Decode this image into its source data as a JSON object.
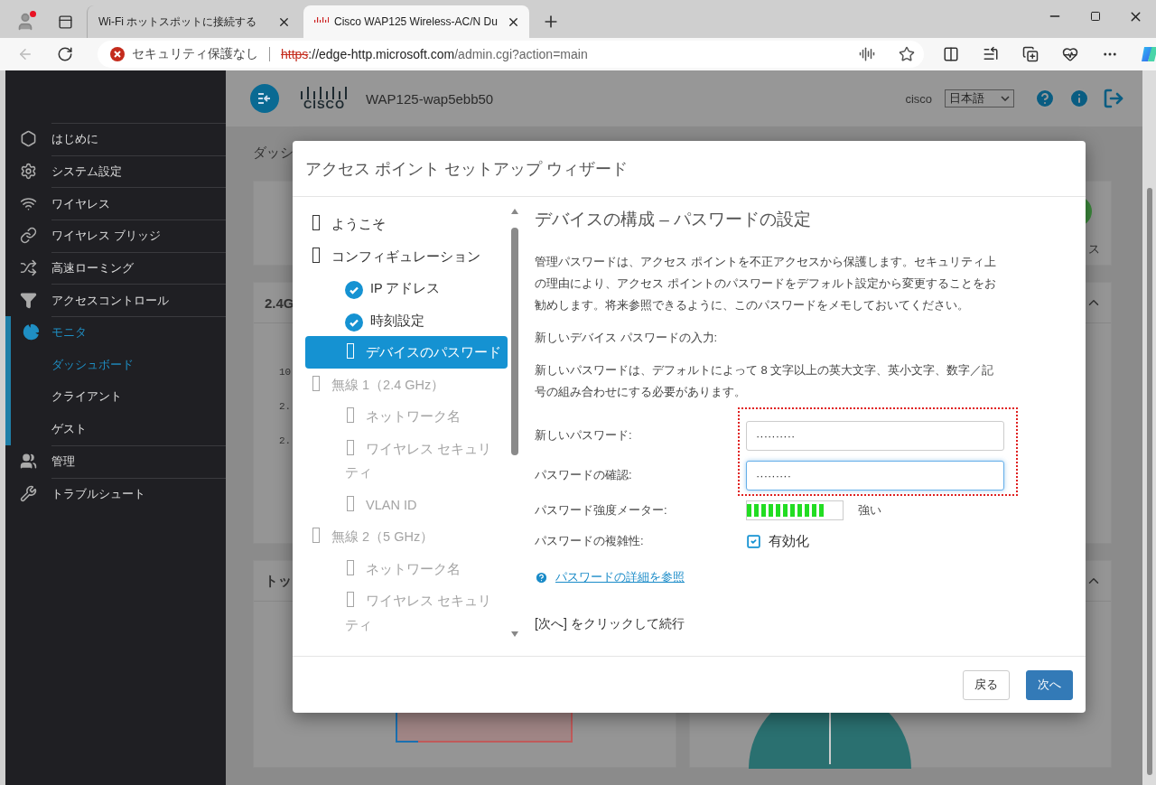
{
  "browser": {
    "tabs": [
      {
        "title": "Wi-Fi ホットスポットに接続する",
        "selected": false
      },
      {
        "title": "Cisco WAP125 Wireless-AC/N Du",
        "selected": true
      }
    ],
    "security_label": "セキュリティ保護なし",
    "url": {
      "scheme": "https",
      "host": "://edge-http.microsoft.com",
      "path": "/admin.cgi?action=main"
    }
  },
  "sidebar": {
    "items": [
      {
        "label": "はじめに",
        "selected": false
      },
      {
        "label": "システム設定",
        "selected": false
      },
      {
        "label": "ワイヤレス",
        "selected": false
      },
      {
        "label": "ワイヤレス ブリッジ",
        "selected": false
      },
      {
        "label": "高速ローミング",
        "selected": false
      },
      {
        "label": "アクセスコントロール",
        "selected": false
      },
      {
        "label": "モニタ",
        "selected": true,
        "children": [
          {
            "label": "ダッシュボード",
            "selected": true
          },
          {
            "label": "クライアント",
            "selected": false
          },
          {
            "label": "ゲスト",
            "selected": false
          }
        ]
      },
      {
        "label": "管理",
        "selected": false
      },
      {
        "label": "トラブルシュート",
        "selected": false
      }
    ]
  },
  "header": {
    "logo": "CISCO",
    "device": "WAP125-wap5ebb50",
    "user": "cisco",
    "language": "日本語"
  },
  "dashboard": {
    "title": "ダッシ",
    "summary_fragment": "ス",
    "panels": [
      {
        "title": "2.4G",
        "axis_labels": [
          "10",
          "2.",
          "2."
        ]
      },
      {
        "title": "トッ"
      }
    ]
  },
  "wizard": {
    "title": "アクセス ポイント セットアップ ウィザード",
    "steps": [
      {
        "label": "ようこそ",
        "completed": false,
        "selected": false,
        "disabled": false
      },
      {
        "label": "コンフィギュレーション",
        "completed": false,
        "selected": false,
        "disabled": false,
        "children": [
          {
            "label": "IP アドレス",
            "completed": true,
            "selected": false,
            "disabled": false
          },
          {
            "label": "時刻設定",
            "completed": true,
            "selected": false,
            "disabled": false
          },
          {
            "label": "デバイスのパスワード",
            "completed": false,
            "selected": true,
            "disabled": false
          }
        ]
      },
      {
        "label": "無線 1（2.4 GHz）",
        "completed": false,
        "selected": false,
        "disabled": true,
        "children": [
          {
            "label": "ネットワーク名",
            "completed": false,
            "selected": false,
            "disabled": true
          },
          {
            "label": "ワイヤレス セキュリティ",
            "completed": false,
            "selected": false,
            "disabled": true
          },
          {
            "label": "VLAN ID",
            "completed": false,
            "selected": false,
            "disabled": true
          }
        ]
      },
      {
        "label": "無線 2（5 GHz）",
        "completed": false,
        "selected": false,
        "disabled": true,
        "children": [
          {
            "label": "ネットワーク名",
            "completed": false,
            "selected": false,
            "disabled": true
          },
          {
            "label": "ワイヤレス セキュリティ",
            "completed": false,
            "selected": false,
            "disabled": true
          }
        ]
      }
    ],
    "heading": "デバイスの構成 – パスワードの設定",
    "intro": "管理パスワードは、アクセス ポイントを不正アクセスから保護します。セキュリティ上の理由により、アクセス ポイントのパスワードをデフォルト設定から変更することをお勧めします。将来参照できるように、このパスワードをメモしておいてください。",
    "prompt": "新しいデバイス パスワードの入力:",
    "rule": "新しいパスワードは、デフォルトによって 8 文字以上の英大文字、英小文字、数字／記号の組み合わせにする必要があります。",
    "fields": [
      {
        "label": "新しいパスワード:",
        "value": "··········",
        "focused": false
      },
      {
        "label": "パスワードの確認:",
        "value": "·········",
        "focused": true
      }
    ],
    "strength": {
      "label": "パスワード強度メーター:",
      "level": 0.8,
      "reading": "強い"
    },
    "complexity": {
      "label": "パスワードの複雑性:",
      "checked": true,
      "text": "有効化"
    },
    "link": "パスワードの詳細を参照",
    "hint": "[次へ] をクリックして続行",
    "buttons": [
      {
        "label": "戻る",
        "kind": "secondary"
      },
      {
        "label": "次へ",
        "kind": "primary"
      }
    ]
  }
}
